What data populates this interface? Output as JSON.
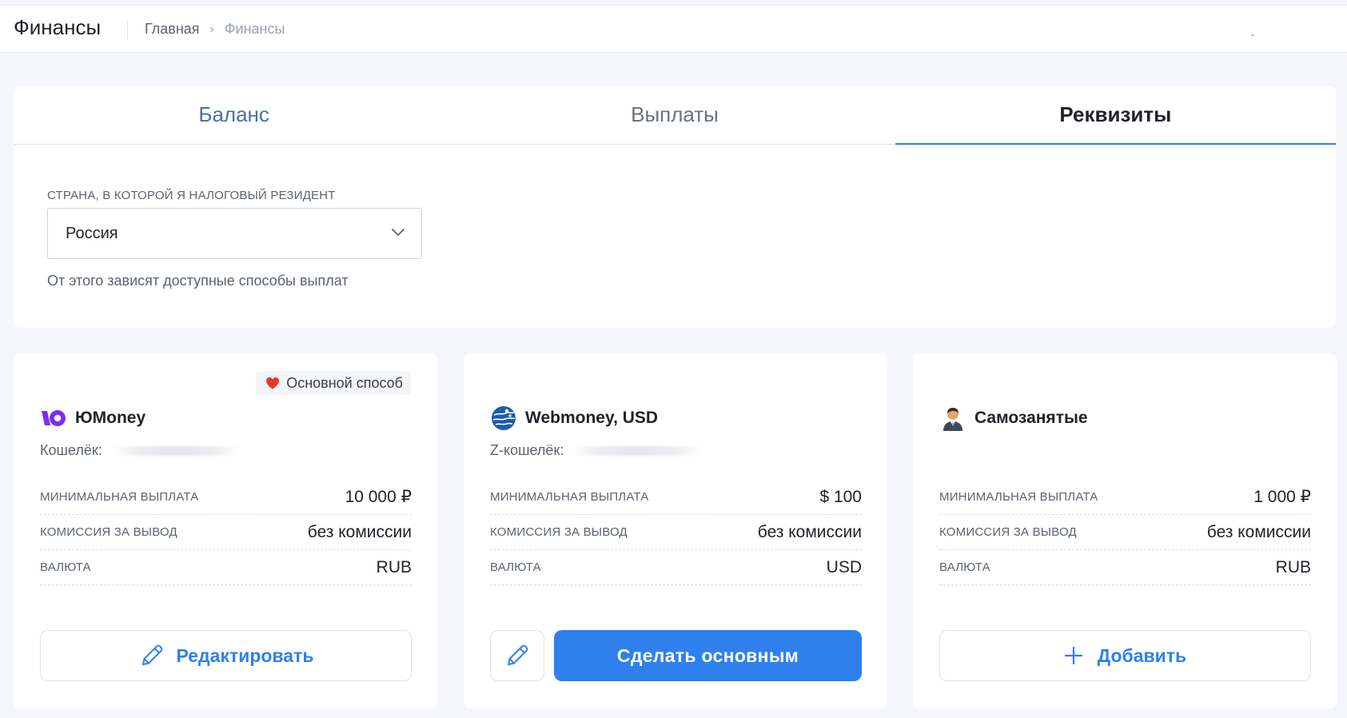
{
  "header": {
    "title": "Финансы",
    "breadcrumb": {
      "home": "Главная",
      "separator": "›",
      "current": "Финансы"
    }
  },
  "tabs": [
    {
      "label": "Баланс",
      "active": false
    },
    {
      "label": "Выплаты",
      "active": false
    },
    {
      "label": "Реквизиты",
      "active": true
    }
  ],
  "country": {
    "label": "СТРАНА, В КОТОРОЙ Я НАЛОГОВЫЙ РЕЗИДЕНТ",
    "value": "Россия",
    "hint": "От этого зависят доступные способы выплат"
  },
  "methods": [
    {
      "name": "ЮMoney",
      "icon": "yoomoney-logo-icon",
      "badge": "Основной способ",
      "wallet_label": "Кошелёк:",
      "rows": [
        {
          "label": "МИНИМАЛЬНАЯ ВЫПЛАТА",
          "value": "10 000 ₽"
        },
        {
          "label": "КОМИССИЯ ЗА ВЫВОД",
          "value": "без комиссии"
        },
        {
          "label": "ВАЛЮТА",
          "value": "RUB"
        }
      ],
      "action_label": "Редактировать"
    },
    {
      "name": "Webmoney, USD",
      "icon": "webmoney-globe-icon",
      "wallet_label": "Z-кошелёк:",
      "rows": [
        {
          "label": "МИНИМАЛЬНАЯ ВЫПЛАТА",
          "value": "$ 100"
        },
        {
          "label": "КОМИССИЯ ЗА ВЫВОД",
          "value": "без комиссии"
        },
        {
          "label": "ВАЛЮТА",
          "value": "USD"
        }
      ],
      "action_label": "Сделать основным"
    },
    {
      "name": "Самозанятые",
      "icon": "businessman-icon",
      "rows": [
        {
          "label": "МИНИМАЛЬНАЯ ВЫПЛАТА",
          "value": "1 000 ₽"
        },
        {
          "label": "КОМИССИЯ ЗА ВЫВОД",
          "value": "без комиссии"
        },
        {
          "label": "ВАЛЮТА",
          "value": "RUB"
        }
      ],
      "action_label": "Добавить"
    }
  ],
  "colors": {
    "accent": "#2f80ed",
    "background": "#f4f6fa",
    "badge_heart": "#e53935",
    "yoomoney_purple": "#7b2cf5"
  }
}
